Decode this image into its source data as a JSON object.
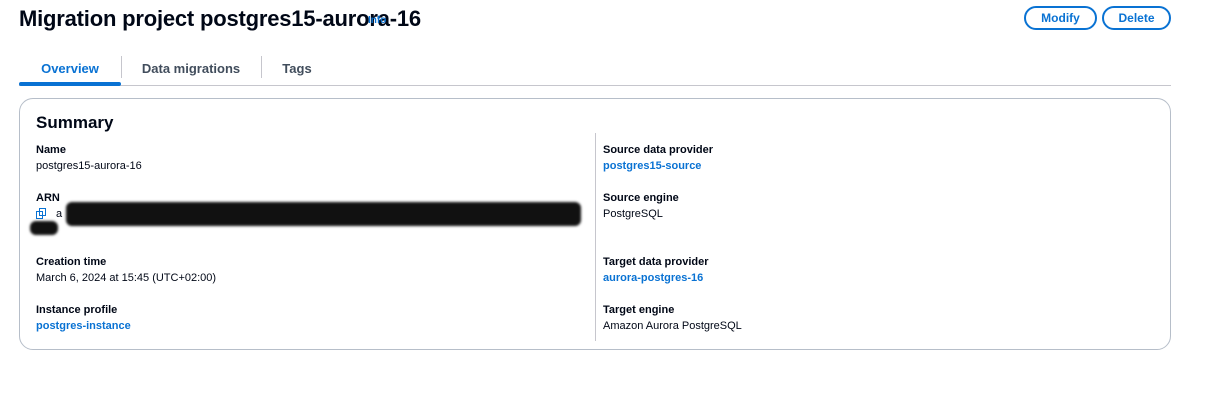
{
  "header": {
    "title": "Migration project postgres15-aurora-16",
    "info_label": "Info",
    "modify_label": "Modify",
    "delete_label": "Delete"
  },
  "tabs": [
    {
      "label": "Overview",
      "active": true
    },
    {
      "label": "Data migrations",
      "active": false
    },
    {
      "label": "Tags",
      "active": false
    }
  ],
  "summary": {
    "title": "Summary",
    "left": {
      "name": {
        "label": "Name",
        "value": "postgres15-aurora-16"
      },
      "arn": {
        "label": "ARN",
        "value_prefix": "a"
      },
      "creation_time": {
        "label": "Creation time",
        "value": "March 6, 2024 at 15:45 (UTC+02:00)"
      },
      "instance_profile": {
        "label": "Instance profile",
        "value": "postgres-instance"
      }
    },
    "right": {
      "source_provider": {
        "label": "Source data provider",
        "value": "postgres15-source"
      },
      "source_engine": {
        "label": "Source engine",
        "value": "PostgreSQL"
      },
      "target_provider": {
        "label": "Target data provider",
        "value": "aurora-postgres-16"
      },
      "target_engine": {
        "label": "Target engine",
        "value": "Amazon Aurora PostgreSQL"
      }
    }
  },
  "colors": {
    "accent": "#0972d3",
    "text": "#000716",
    "border": "#b6bec9"
  },
  "icons": {
    "copy": "copy-icon"
  }
}
